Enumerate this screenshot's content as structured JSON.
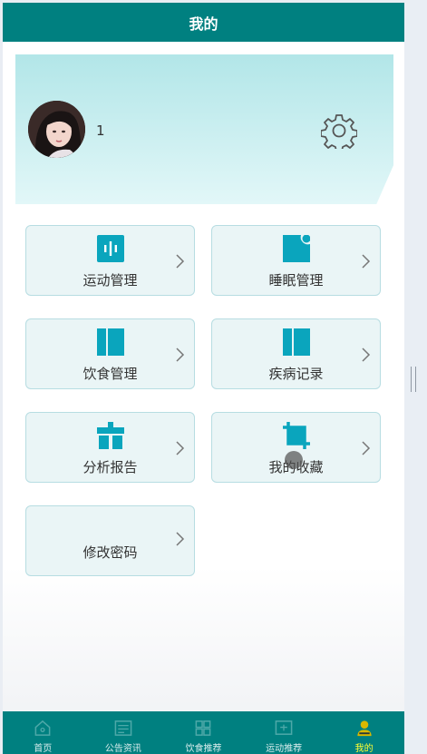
{
  "header": {
    "title": "我的"
  },
  "profile": {
    "user_name": "1",
    "avatar": "user-avatar-photo",
    "settings_icon": "gear-icon"
  },
  "menu": [
    {
      "label": "运动管理",
      "icon": "waveform-icon"
    },
    {
      "label": "睡眠管理",
      "icon": "notification-square-icon"
    },
    {
      "label": "饮食管理",
      "icon": "book-panel-icon"
    },
    {
      "label": "疾病记录",
      "icon": "book-panel-icon"
    },
    {
      "label": "分析报告",
      "icon": "toolbox-icon"
    },
    {
      "label": "我的收藏",
      "icon": "crop-icon"
    },
    {
      "label": "修改密码",
      "icon": ""
    }
  ],
  "tabbar": {
    "items": [
      {
        "label": "首页",
        "icon": "home-icon"
      },
      {
        "label": "公告资讯",
        "icon": "news-icon"
      },
      {
        "label": "饮食推荐",
        "icon": "grid-icon"
      },
      {
        "label": "运动推荐",
        "icon": "board-icon"
      },
      {
        "label": "我的",
        "icon": "person-icon"
      }
    ],
    "active_index": 4
  },
  "colors": {
    "primary": "#008080",
    "accent_icon": "#0aa5bd",
    "active_tab_label": "#ffff33",
    "tile_background": "#eaf5f6"
  }
}
